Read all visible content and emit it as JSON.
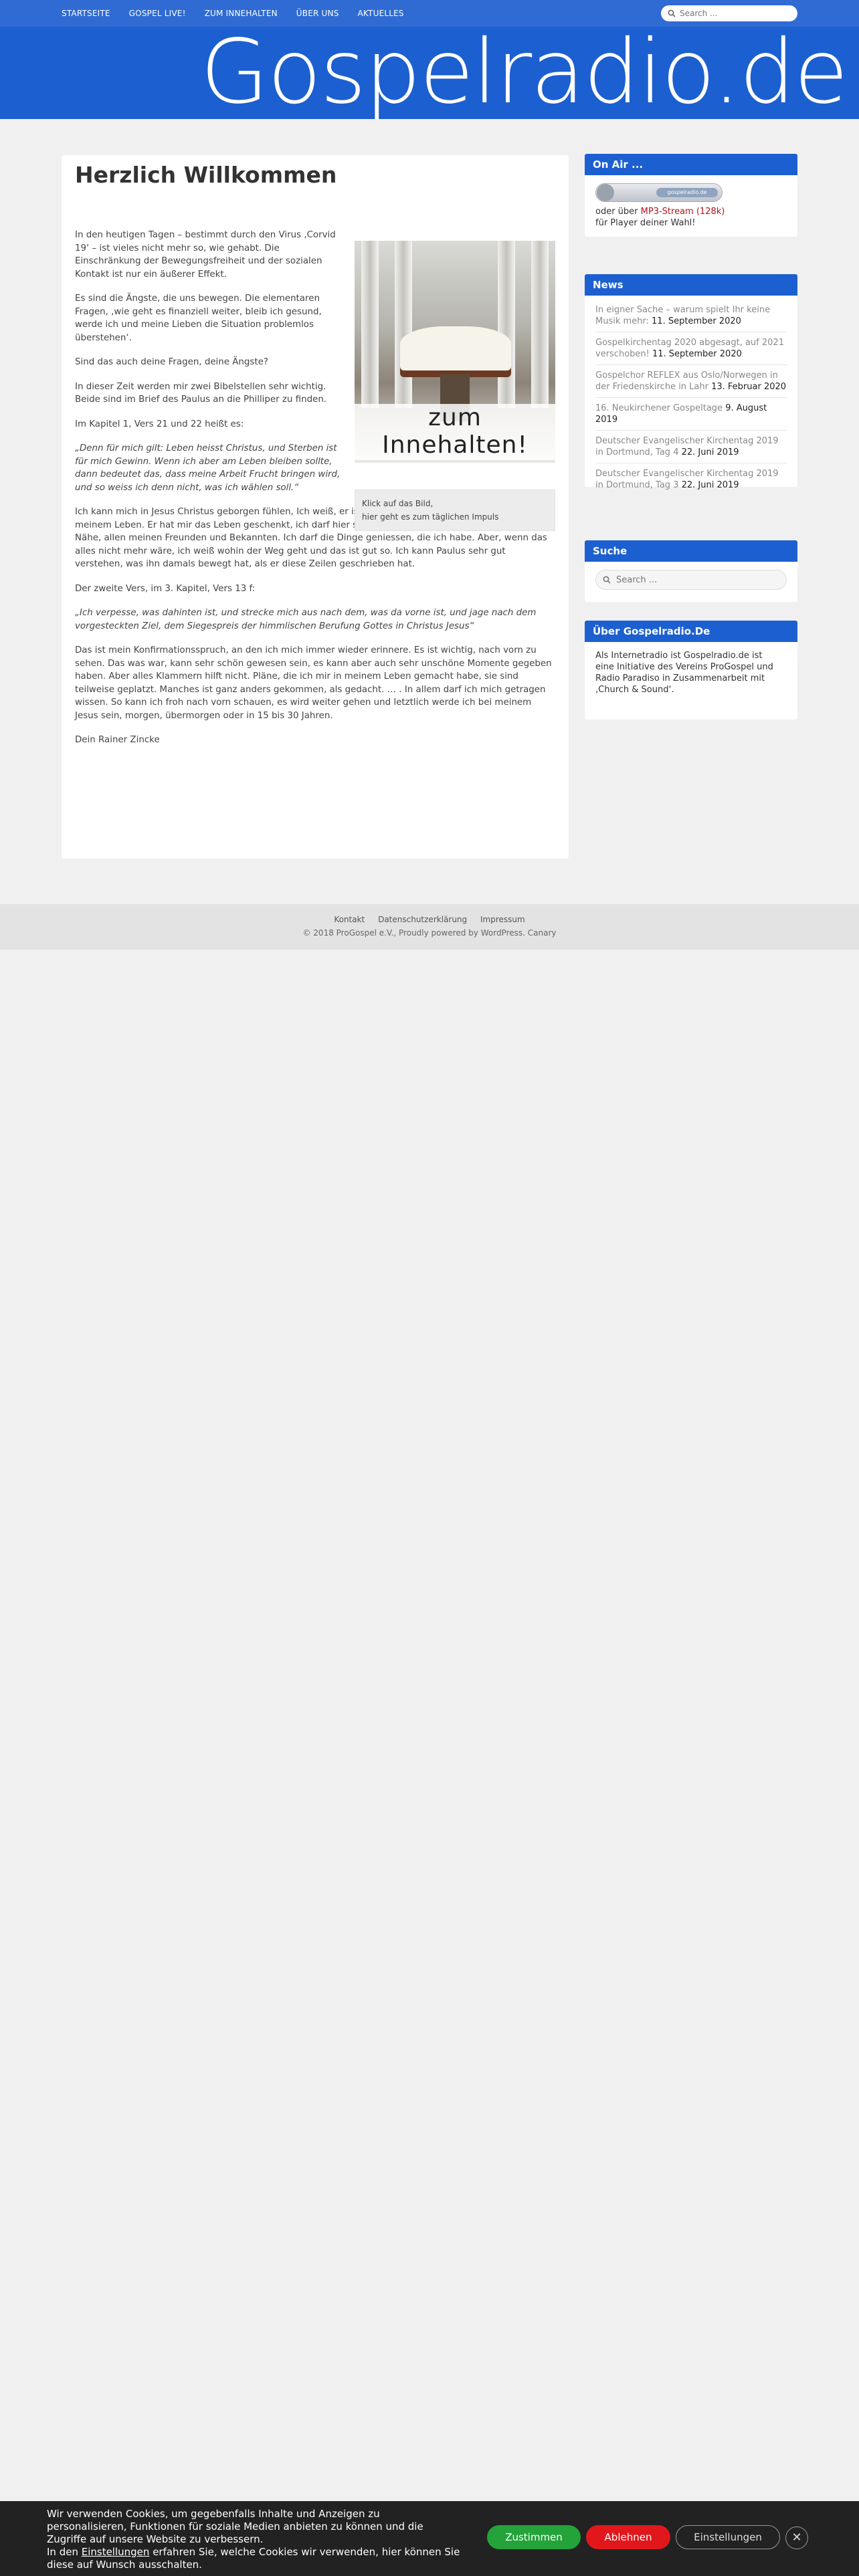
{
  "nav": {
    "items": [
      "STARTSEITE",
      "GOSPEL LIVE!",
      "ZUM INNEHALTEN",
      "ÜBER UNS",
      "AKTUELLES"
    ],
    "search_placeholder": "Search ..."
  },
  "banner": {
    "logo": "Gospelradio.de"
  },
  "article": {
    "title": "Herzlich Willkommen",
    "p1": "In den heutigen Tagen – bestimmt durch den Virus ‚Corvid 19‘ – ist vieles nicht mehr so, wie gehabt. Die Einschränkung der Bewegungsfreiheit und der sozialen Kontakt ist nur ein äußerer Effekt.",
    "p2": "Es sind die Ängste, die uns bewegen. Die elementaren Fragen, ‚wie geht es finanziell weiter, bleib ich gesund, werde ich und meine Lieben die Situation problemlos überstehen‘.",
    "p3": "Sind das auch deine Fragen, deine Ängste?",
    "p4": "In dieser Zeit werden mir zwei Bibelstellen sehr wichtig. Beide sind im Brief des Paulus an die Philliper zu finden.",
    "p5": "Im Kapitel 1, Vers 21 und 22 heißt es:",
    "q1": "„Denn für mich gilt: Leben heisst Christus, und Sterben ist für mich Gewinn. Wenn ich aber am Leben bleiben sollte, dann bedeutet das, dass meine Arbeit Frucht bringen wird, und so weiss ich denn nicht, was ich wählen soll.“",
    "p6": "Ich kann mich in Jesus Christus geborgen fühlen, Ich weiß, er ist da und trägt mich. Das ist das wichtige in meinem Leben. Er hat mir das Leben geschenkt, ich darf hier sein, umgeben mit allen Lieben in meiner Nähe, allen meinen Freunden und Bekannten. Ich darf die Dinge geniessen, die ich habe. Aber, wenn das alles nicht mehr wäre, ich weiß wohin der Weg geht und das ist gut so. Ich kann Paulus sehr gut verstehen, was ihn damals bewegt hat, als er diese Zeilen geschrieben hat.",
    "p7": "Der zweite Vers, im 3. Kapitel, Vers 13 f:",
    "q2": "„Ich verpesse, was dahinten ist, und strecke mich aus nach dem, was da vorne ist, und jage nach dem vorgesteckten Ziel, dem Siegespreis der himmlischen Berufung Gottes in Christus Jesus“",
    "p8": "Das ist mein Konfirmationsspruch, an den ich mich immer wieder erinnere. Es ist wichtig, nach vorn zu sehen. Das was war, kann sehr schön gewesen sein, es kann aber auch sehr unschöne Momente gegeben haben. Aber alles Klammern hilft nicht. Pläne, die ich mir in meinem Leben gemacht habe, sie sind teilweise geplatzt. Manches ist ganz anders gekommen, als gedacht. … . In allem darf ich mich getragen wissen. So kann ich froh nach vorn schauen, es wird weiter gehen und letztlich werde ich bei meinem Jesus sein, morgen, übermorgen oder in 15 bis 30 Jahren.",
    "sign": "Dein Rainer Zincke",
    "figure_text": "zum Innehalten!",
    "caption_1": "Klick auf das Bild,",
    "caption_2": "hier geht es zum täglichen Impuls"
  },
  "sidebar": {
    "onair": {
      "title": "On Air ...",
      "player_label": "gospelradio.de",
      "or_via": "oder über ",
      "stream_link": "MP3-Stream (128k)",
      "for_player": "für Player deiner Wahl!"
    },
    "news": {
      "title": "News",
      "items": [
        {
          "title": "In eigner Sache – warum spielt Ihr keine Musik mehr: ",
          "date": "11. September 2020"
        },
        {
          "title": "Gospelkirchentag 2020 abgesagt, auf 2021 verschoben! ",
          "date": "11. September 2020"
        },
        {
          "title": "Gospelchor REFLEX aus Oslo/Norwegen in der Friedenskirche in Lahr ",
          "date": "13. Februar 2020"
        },
        {
          "title": "16. Neukirchener Gospeltage ",
          "date": "9. August 2019"
        },
        {
          "title": "Deutscher Evangelischer Kirchentag 2019 in Dortmund, Tag 4 ",
          "date": "22. Juni 2019"
        },
        {
          "title": "Deutscher Evangelischer Kirchentag 2019 in Dortmund, Tag 3 ",
          "date": "22. Juni 2019"
        }
      ]
    },
    "search": {
      "title": "Suche",
      "placeholder": "Search ..."
    },
    "about": {
      "title": "Über Gospelradio.De",
      "text": "Als Internetradio ist Gospelradio.de ist eine Initiative des Vereins ProGospel und Radio Paradiso in Zusammenarbeit mit ‚Church & Sound‘."
    }
  },
  "footer": {
    "links": [
      "Kontakt",
      "Datenschutzerklärung",
      "Impressum"
    ],
    "copyright": "© 2018 ProGospel e.V., Proudly powered by WordPress. Canary"
  },
  "cookie": {
    "text_1": "Wir verwenden Cookies, um gegebenfalls Inhalte und Anzeigen zu personalisieren, Funktionen für soziale Medien anbieten zu können und die Zugriffe auf unsere Website zu verbessern.",
    "text_2a": "In den ",
    "settings_link": "Einstellungen",
    "text_2b": " erfahren Sie, welche Cookies wir verwenden, hier können Sie diese auf Wunsch ausschalten.",
    "accept": "Zustimmen",
    "decline": "Ablehnen",
    "settings": "Einstellungen",
    "close": "✕"
  }
}
